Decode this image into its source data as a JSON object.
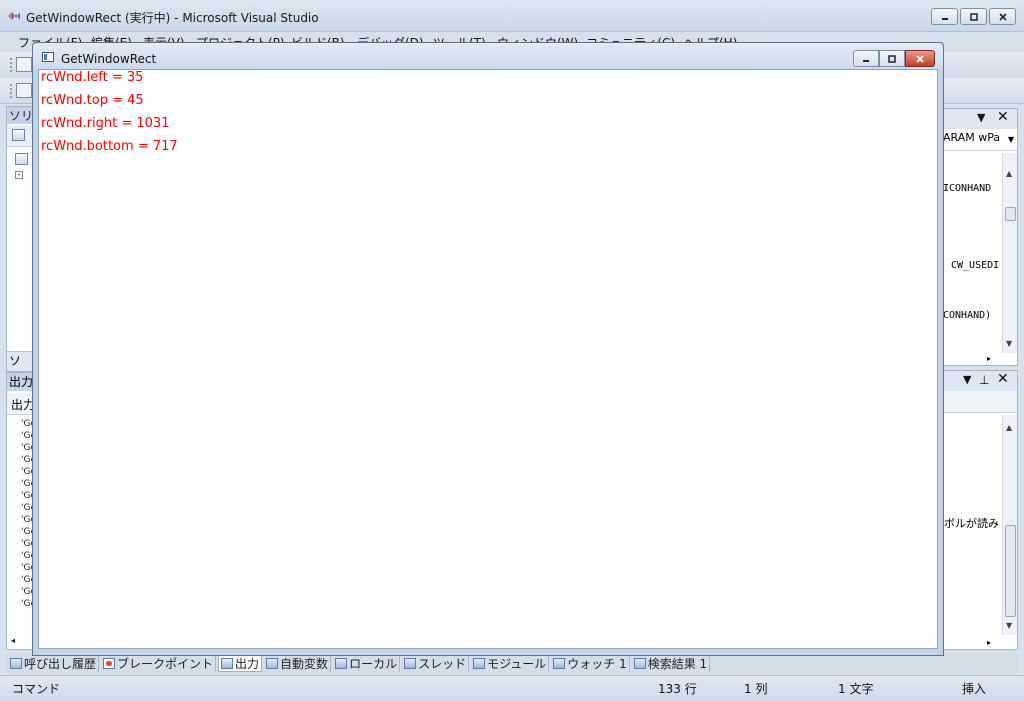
{
  "vs_window": {
    "title": "GetWindowRect (実行中) - Microsoft Visual Studio",
    "menu": [
      "ファイル(F)",
      "編集(E)",
      "表示(V)",
      "プロジェクト(P)",
      "ビルド(B)",
      "デバッグ(D)",
      "ツール(T)",
      "ウィンドウ(W)",
      "コミュニティ(C)",
      "ヘルプ(H)"
    ]
  },
  "left_dock": {
    "header": "ソリ",
    "footer": "ソ"
  },
  "right_dock": {
    "combo_text": "ARAM wPa",
    "code_lines": [
      "ICONHAND",
      "CW_USEDI",
      "CONHAND)"
    ]
  },
  "output_dock": {
    "header": "出力",
    "toolbar": "出力",
    "lines": [
      "'Ge",
      "'Ge",
      "'Ge",
      "'Ge",
      "'Ge",
      "'Ge",
      "'Ge",
      "'Ge",
      "'Ge",
      "'Ge",
      "'Ge",
      "'Ge",
      "'Ge",
      "'Ge",
      "'Ge",
      "'Ge"
    ]
  },
  "right_output": {
    "text": "ボルが読み"
  },
  "tabs": [
    {
      "label": "呼び出し履歴"
    },
    {
      "label": "ブレークポイント"
    },
    {
      "label": "出力"
    },
    {
      "label": "自動変数"
    },
    {
      "label": "ローカル"
    },
    {
      "label": "スレッド"
    },
    {
      "label": "モジュール"
    },
    {
      "label": "ウォッチ 1"
    },
    {
      "label": "検索結果 1"
    }
  ],
  "status_bar": {
    "mode": "コマンド",
    "line": "133 行",
    "column": "1 列",
    "char": "1 文字",
    "insert": "挿入"
  },
  "child_window": {
    "title": "GetWindowRect",
    "text_color": "#ff0000",
    "lines": [
      "rcWnd.left = 35",
      "rcWnd.top = 45",
      "rcWnd.right = 1031",
      "rcWnd.bottom = 717"
    ]
  }
}
